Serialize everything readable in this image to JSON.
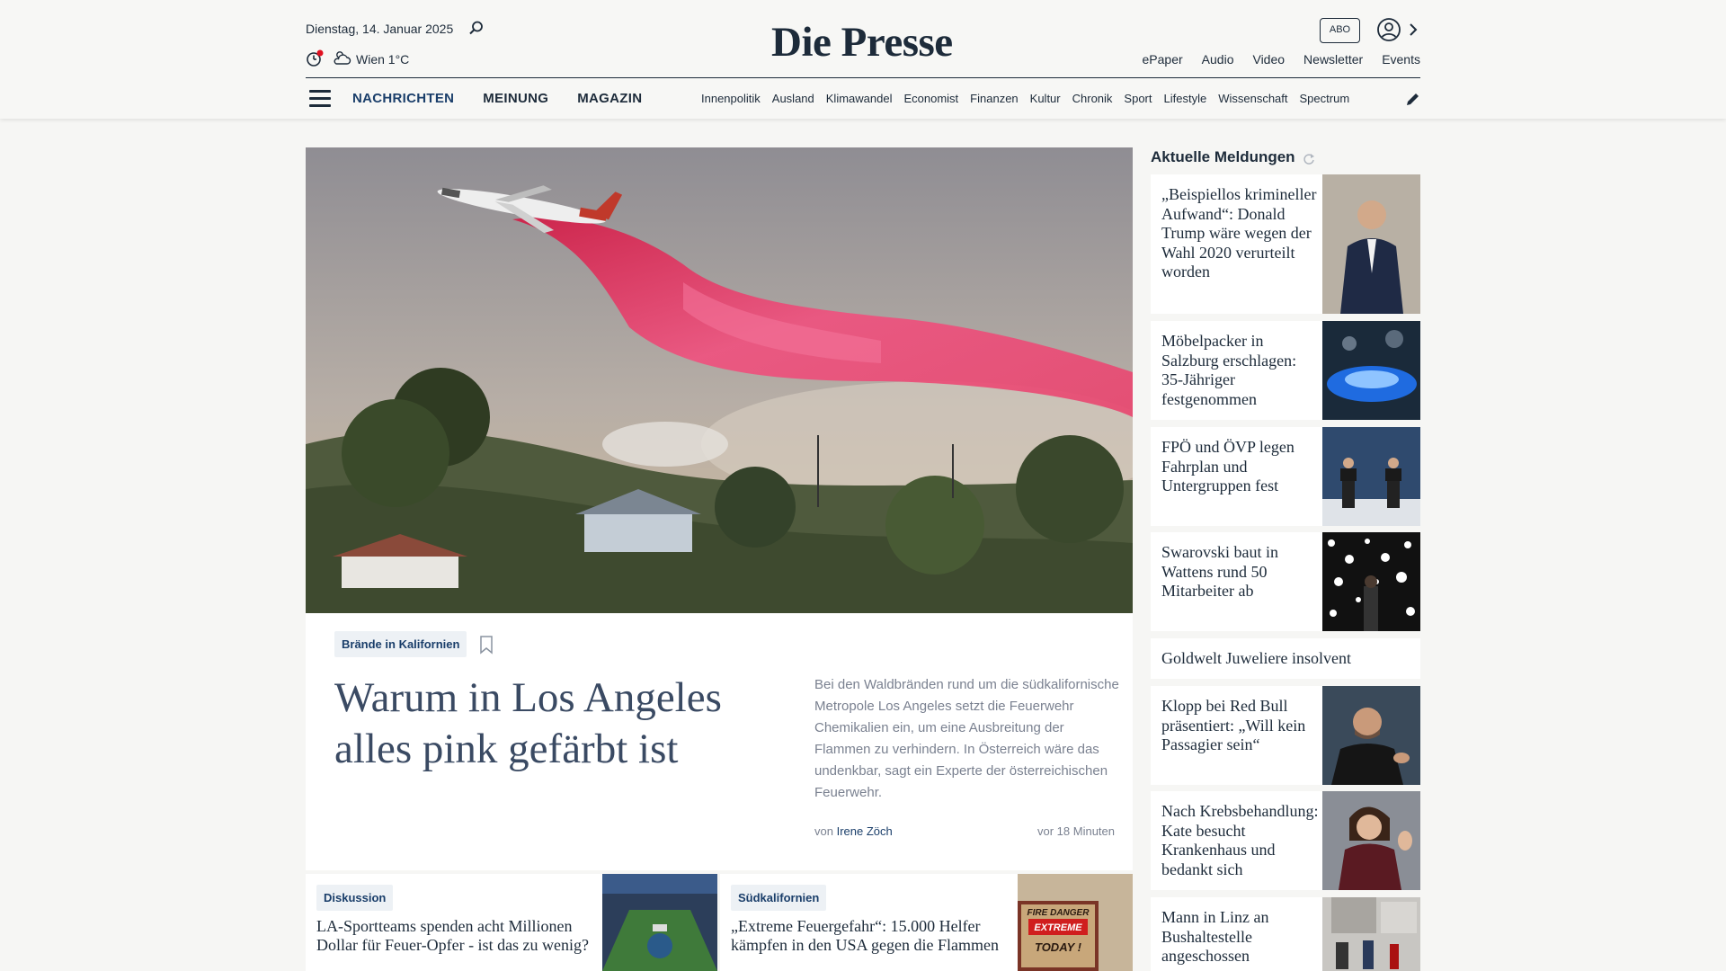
{
  "header": {
    "date": "Dienstag, 14. Januar 2025",
    "weather": "Wien 1°C",
    "logo": "Die Presse",
    "abo_label": "ABO",
    "top_links": [
      "ePaper",
      "Audio",
      "Video",
      "Newsletter",
      "Events"
    ],
    "main_nav": [
      "NACHRICHTEN",
      "MEINUNG",
      "MAGAZIN"
    ],
    "sub_nav": [
      "Innenpolitik",
      "Ausland",
      "Klimawandel",
      "Economist",
      "Finanzen",
      "Kultur",
      "Chronik",
      "Sport",
      "Lifestyle",
      "Wissenschaft",
      "Spectrum"
    ]
  },
  "hero": {
    "tag": "Brände in Kalifornien",
    "headline": "Warum in Los Angeles alles pink gefärbt ist",
    "teaser": "Bei den Waldbränden rund um die südkalifornische Metropole Los Angeles setzt die Feuerwehr Chemikalien ein, um eine Ausbreitung der Flammen zu verhindern. In Österreich wäre das undenkbar, sagt ein Experte der österreichischen Feuerwehr.",
    "byline_prefix": "von",
    "author": "Irene Zöch",
    "time_ago": "vor 18 Minuten"
  },
  "cards": [
    {
      "tag": "Diskussion",
      "title": "LA-Sportteams spenden acht Millionen Dollar für Feuer-Opfer - ist das zu wenig?"
    },
    {
      "tag": "Südkalifornien",
      "title": "„Extreme Feuergefahr“: 15.000 Helfer kämpfen in den USA gegen die Flammen",
      "image_text": [
        "FIRE DANGER",
        "EXTREME",
        "TODAY !"
      ]
    }
  ],
  "sidebar": {
    "title": "Aktuelle Meldungen",
    "items": [
      {
        "title": "„Beispiellos krimineller Aufwand“: Donald Trump wäre wegen der Wahl 2020 verurteilt worden"
      },
      {
        "title": "Möbelpacker in Salzburg erschlagen: 35-Jähriger festgenommen"
      },
      {
        "title": "FPÖ und ÖVP legen Fahrplan und Untergruppen fest"
      },
      {
        "title": "Swarovski baut in Wattens rund 50 Mitarbeiter ab"
      },
      {
        "title": "Goldwelt Juweliere insolvent"
      },
      {
        "title": "Klopp bei Red Bull präsentiert: „Will kein Passagier sein“"
      },
      {
        "title": "Nach Krebsbehandlung: Kate besucht Krankenhaus und bedankt sich"
      },
      {
        "title": "Mann in Linz an Bushaltestelle angeschossen"
      }
    ]
  },
  "colors": {
    "brand": "#1d2b3a",
    "accent": "#1a3e6a",
    "tag_bg": "#edf1f5",
    "pink_retardant": "#e8456e"
  },
  "icons": [
    "search-icon",
    "reading-meter-icon",
    "weather-icon",
    "user-icon",
    "chevron-right-icon",
    "menu-icon",
    "pen-icon",
    "bookmark-icon",
    "refresh-icon"
  ]
}
